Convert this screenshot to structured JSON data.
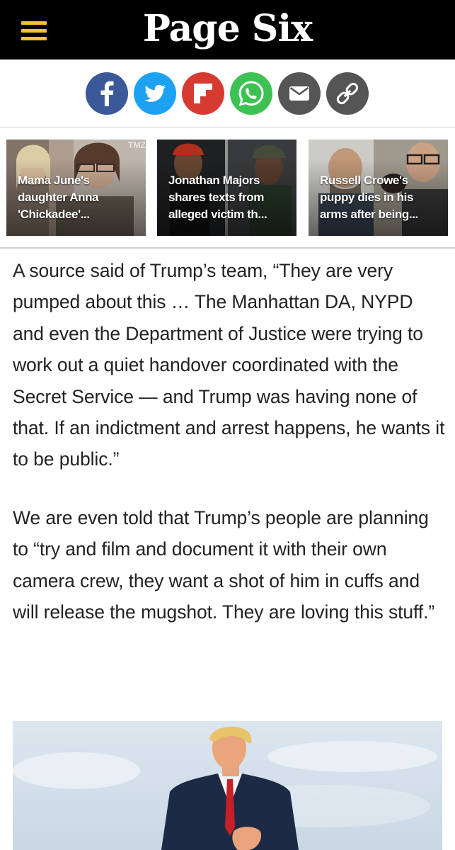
{
  "header": {
    "logo": "Page Six",
    "menu_icon": "hamburger-menu-icon",
    "accent_color": "#f2c230",
    "background_color": "#000000"
  },
  "share": {
    "buttons": [
      {
        "name": "facebook",
        "icon": "facebook-icon",
        "color": "#3b5998"
      },
      {
        "name": "twitter",
        "icon": "twitter-icon",
        "color": "#1da1f2"
      },
      {
        "name": "flipboard",
        "icon": "flipboard-icon",
        "color": "#d63a30"
      },
      {
        "name": "whatsapp",
        "icon": "whatsapp-icon",
        "color": "#3cc152"
      },
      {
        "name": "email",
        "icon": "email-icon",
        "color": "#555555"
      },
      {
        "name": "copy-link",
        "icon": "link-icon",
        "color": "#555555"
      }
    ]
  },
  "teasers": [
    {
      "caption": "Mama June's daughter Anna 'Chickadee'..."
    },
    {
      "caption": "Jonathan Majors shares texts from alleged victim th..."
    },
    {
      "caption": "Russell Crowe's puppy dies in his arms after being..."
    }
  ],
  "article": {
    "paragraphs": [
      "A source said of Trump’s team, “They are very pumped about this … The Manhattan DA, NYPD and even the Department of Justice were trying to work out a quiet handover coordinated with the Secret Service — and Trump was having none of that. If an indictment and arrest happens, he wants it to be public.”",
      "We are even told that Trump’s people are planning to “try and film and document it with their own camera crew, they want a shot of him in cuffs and will release the mugshot. They are loving this stuff.”"
    ]
  }
}
